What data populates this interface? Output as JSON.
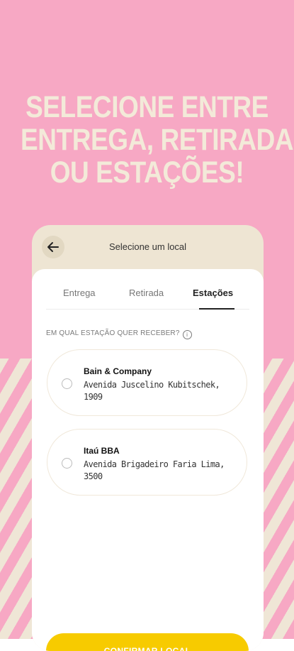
{
  "headline": {
    "line1": "SELECIONE ENTRE",
    "line2": "ENTREGA, RETIRADA",
    "line3": "OU ESTAÇÕES!"
  },
  "header": {
    "title": "Selecione um local",
    "back_icon": "arrow-left-icon"
  },
  "tabs": [
    {
      "label": "Entrega",
      "active": false
    },
    {
      "label": "Retirada",
      "active": false
    },
    {
      "label": "Estações",
      "active": true
    }
  ],
  "question": {
    "text": "EM QUAL ESTAÇÃO QUER RECEBER?",
    "info_icon": "i"
  },
  "stations": [
    {
      "name": "Bain & Company",
      "address_line1": "Avenida Juscelino Kubitschek,",
      "address_line2": "1909"
    },
    {
      "name": "Itaú BBA",
      "address_line1": "Avenida Brigadeiro Faria Lima,",
      "address_line2": "3500"
    }
  ],
  "confirm_button": {
    "label": "CONFIRMAR LOCAL"
  },
  "colors": {
    "pink": "#F7A8C4",
    "cream": "#EFE6D6",
    "yellow": "#F7CB00",
    "headline": "#F3EAD9"
  }
}
